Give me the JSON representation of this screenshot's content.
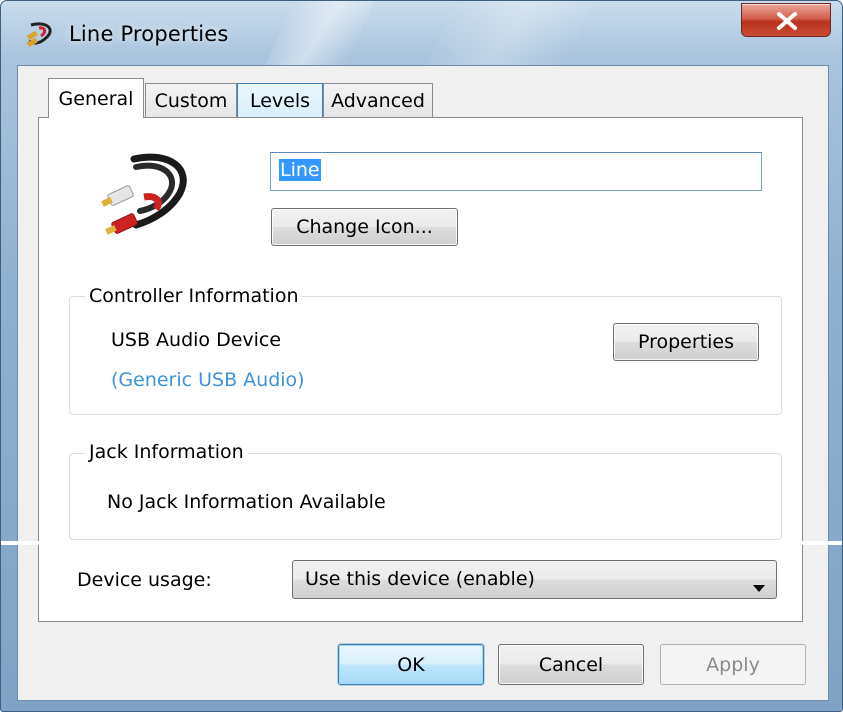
{
  "window": {
    "title": "Line Properties",
    "close_icon": "close-icon"
  },
  "tabs": [
    {
      "label": "General",
      "active": true
    },
    {
      "label": "Custom",
      "active": false
    },
    {
      "label": "Levels",
      "active": false
    },
    {
      "label": "Advanced",
      "active": false
    }
  ],
  "general": {
    "device_icon": "rca-cable-icon",
    "name_value": "Line",
    "change_icon_label": "Change Icon...",
    "controller": {
      "legend": "Controller Information",
      "device_name": "USB Audio Device",
      "driver_name": "(Generic USB Audio)",
      "properties_label": "Properties"
    },
    "jack": {
      "legend": "Jack Information",
      "text": "No Jack Information Available"
    },
    "device_usage": {
      "label": "Device usage:",
      "selected": "Use this device (enable)"
    }
  },
  "footer": {
    "ok_label": "OK",
    "cancel_label": "Cancel",
    "apply_label": "Apply"
  },
  "colors": {
    "selection": "#3399ff",
    "link_text": "#3f93dc",
    "close_button": "#c94c34"
  }
}
